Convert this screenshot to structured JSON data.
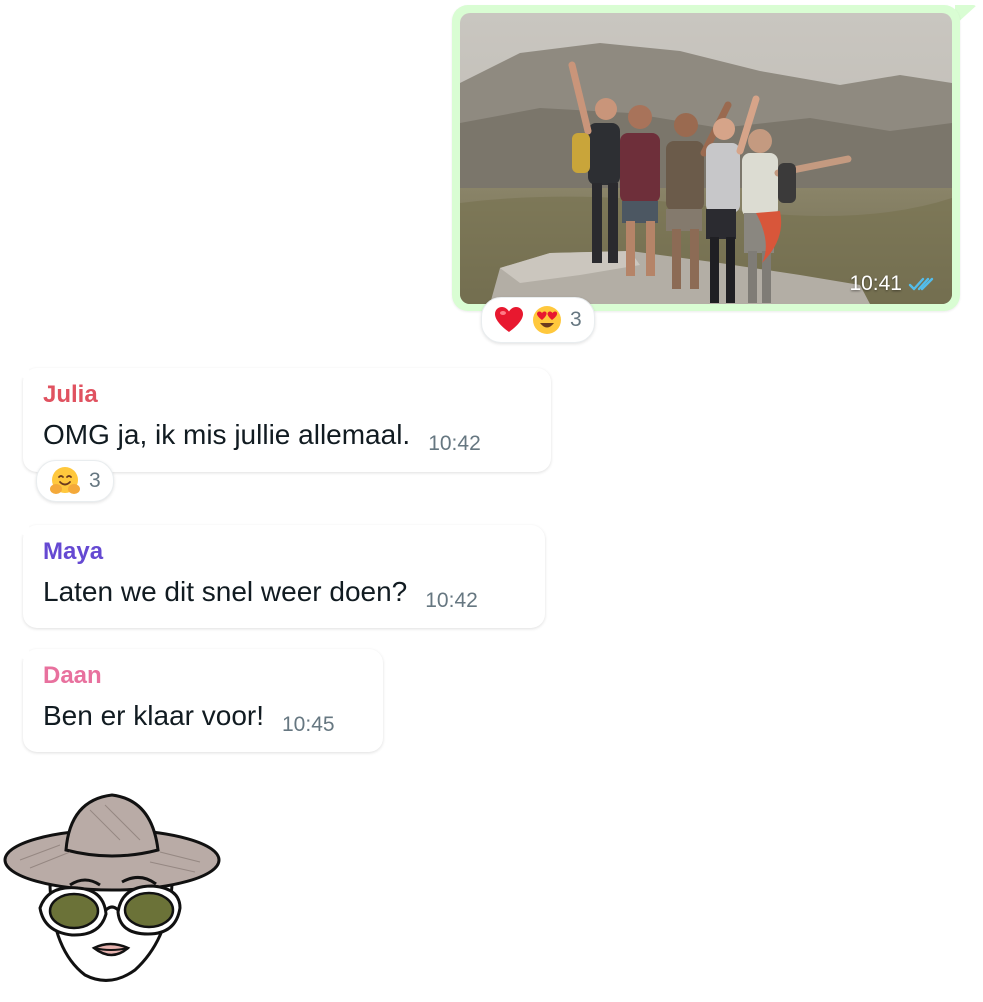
{
  "outgoing_photo": {
    "time": "10:41",
    "status_icon": "double-check-read-icon",
    "reactions": {
      "emojis": [
        "red-heart-emoji",
        "heart-eyes-emoji"
      ],
      "count": "3"
    }
  },
  "messages": [
    {
      "sender": "Julia",
      "text": "OMG ja, ik mis jullie allemaal.",
      "time": "10:42",
      "sender_color": "#e05260",
      "reactions": {
        "emojis": [
          "hugging-face-emoji"
        ],
        "count": "3"
      }
    },
    {
      "sender": "Maya",
      "text": "Laten we dit snel weer doen?",
      "time": "10:42",
      "sender_color": "#6549d2"
    },
    {
      "sender": "Daan",
      "text": "Ben er klaar voor!",
      "time": "10:45",
      "sender_color": "#e8719e"
    }
  ],
  "colors": {
    "outgoing_bubble": "#d9fdd3",
    "read_ticks": "#53bdeb",
    "timestamp": "#667781"
  },
  "avatar": {
    "icon": "sketched-woman-hat-sunglasses-icon"
  }
}
